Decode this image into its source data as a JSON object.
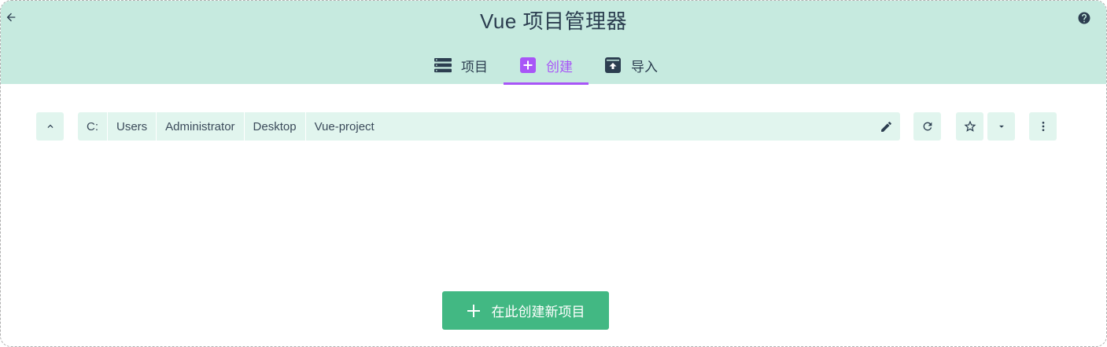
{
  "header": {
    "title": "Vue 项目管理器",
    "back_icon": "arrow-left-icon",
    "help_icon": "help-circle-icon",
    "background": "#c6eadf"
  },
  "tabs": [
    {
      "label": "项目",
      "icon": "list-icon",
      "active": false
    },
    {
      "label": "创建",
      "icon": "add-box-icon",
      "active": true
    },
    {
      "label": "导入",
      "icon": "unarchive-icon",
      "active": false
    }
  ],
  "accent": "#a855f7",
  "folder_toolbar": {
    "up_icon": "chevron-up-icon",
    "path": [
      "C:",
      "Users",
      "Administrator",
      "Desktop",
      "Vue-project"
    ],
    "edit_icon": "pencil-icon",
    "refresh_icon": "refresh-icon",
    "favorite_icon": "star-outline-icon",
    "favorites_dropdown_icon": "caret-down-icon",
    "more_icon": "more-vert-icon",
    "background": "#e1f5ee"
  },
  "create_button": {
    "label": "在此创建新项目",
    "icon": "plus-icon",
    "color": "#42b883"
  }
}
